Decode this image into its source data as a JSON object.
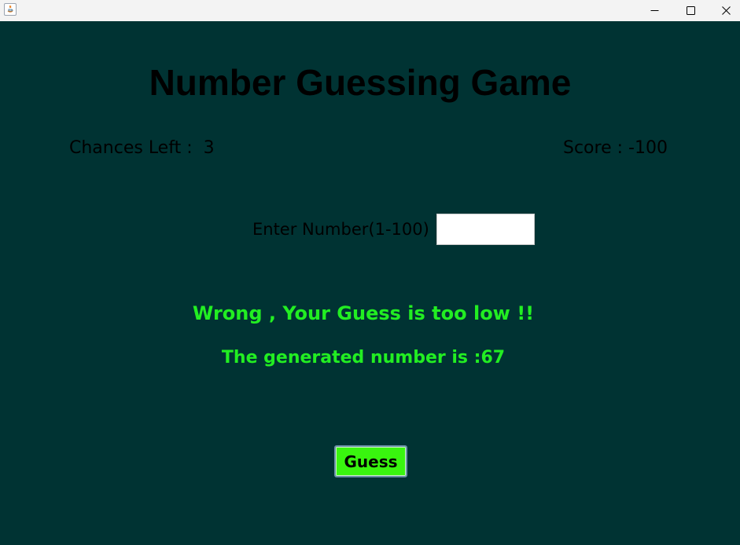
{
  "window": {
    "icon": "java-icon",
    "controls": {
      "minimize_icon": "minimize-icon",
      "maximize_icon": "maximize-icon",
      "close_icon": "close-icon"
    }
  },
  "game": {
    "title": "Number Guessing Game",
    "chances_text": "Chances Left :  3",
    "score_text": "Score : -100",
    "input_label": "Enter Number(1-100)",
    "input_value": "",
    "result_message": "Wrong , Your Guess is too low !!",
    "generated_message": "The generated number is :67",
    "guess_button_label": "Guess"
  },
  "colors": {
    "background": "#003333",
    "message": "#22ee22",
    "button": "#39f50f",
    "title_text": "#000000"
  }
}
